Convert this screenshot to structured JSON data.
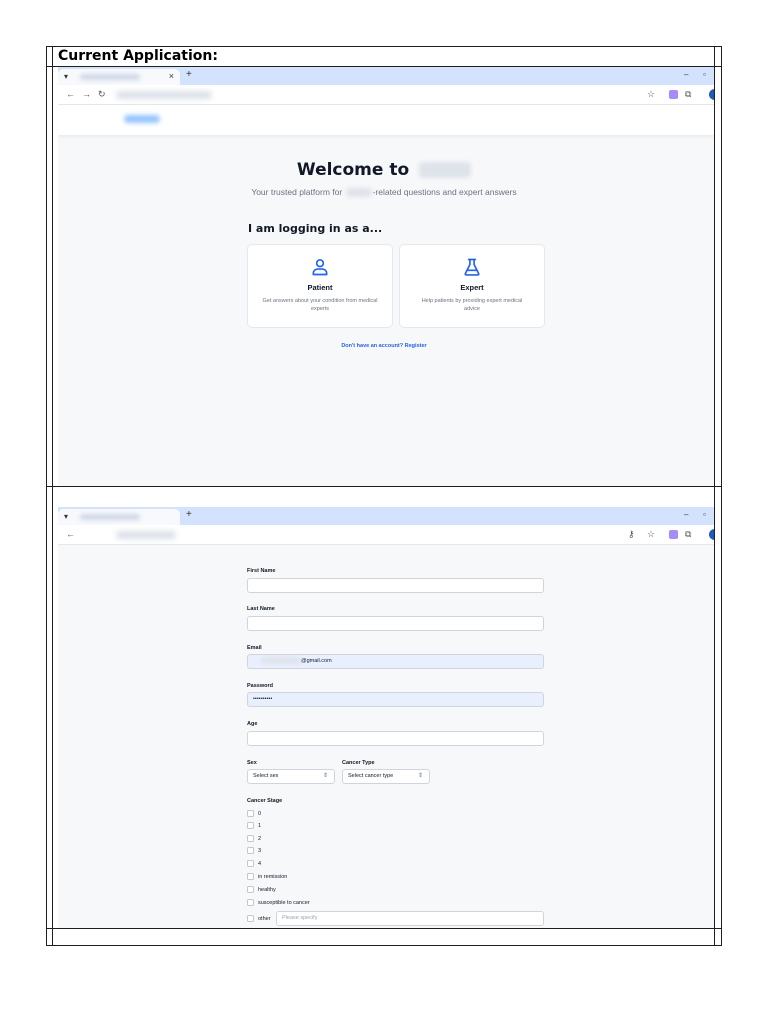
{
  "caption": "Current Application:",
  "browser1": {
    "tab_close": "×",
    "new_tab": "+",
    "minimize": "–",
    "maximize": "▫"
  },
  "login": {
    "title_prefix": "Welcome to",
    "subtitle_prefix": "Your trusted platform for",
    "subtitle_suffix": "-related questions and expert answers",
    "login_as": "I am logging in as a...",
    "cards": [
      {
        "title": "Patient",
        "desc": "Get answers about your condition from medical experts"
      },
      {
        "title": "Expert",
        "desc": "Help patients by providing expert medical advice"
      }
    ],
    "register": "Don't have an account? Register"
  },
  "form": {
    "first_name_label": "First Name",
    "last_name_label": "Last Name",
    "email_label": "Email",
    "email_suffix": "@gmail.com",
    "password_label": "Password",
    "password_value": "••••••••••",
    "age_label": "Age",
    "sex_label": "Sex",
    "sex_select": "Select sex",
    "cancer_type_label": "Cancer Type",
    "cancer_type_select": "Select cancer type",
    "cancer_stage_label": "Cancer Stage",
    "stages": [
      "0",
      "1",
      "2",
      "3",
      "4",
      "in remission",
      "healthy",
      "susceptible to cancer"
    ],
    "other_label": "other",
    "other_placeholder": "Please specify"
  }
}
